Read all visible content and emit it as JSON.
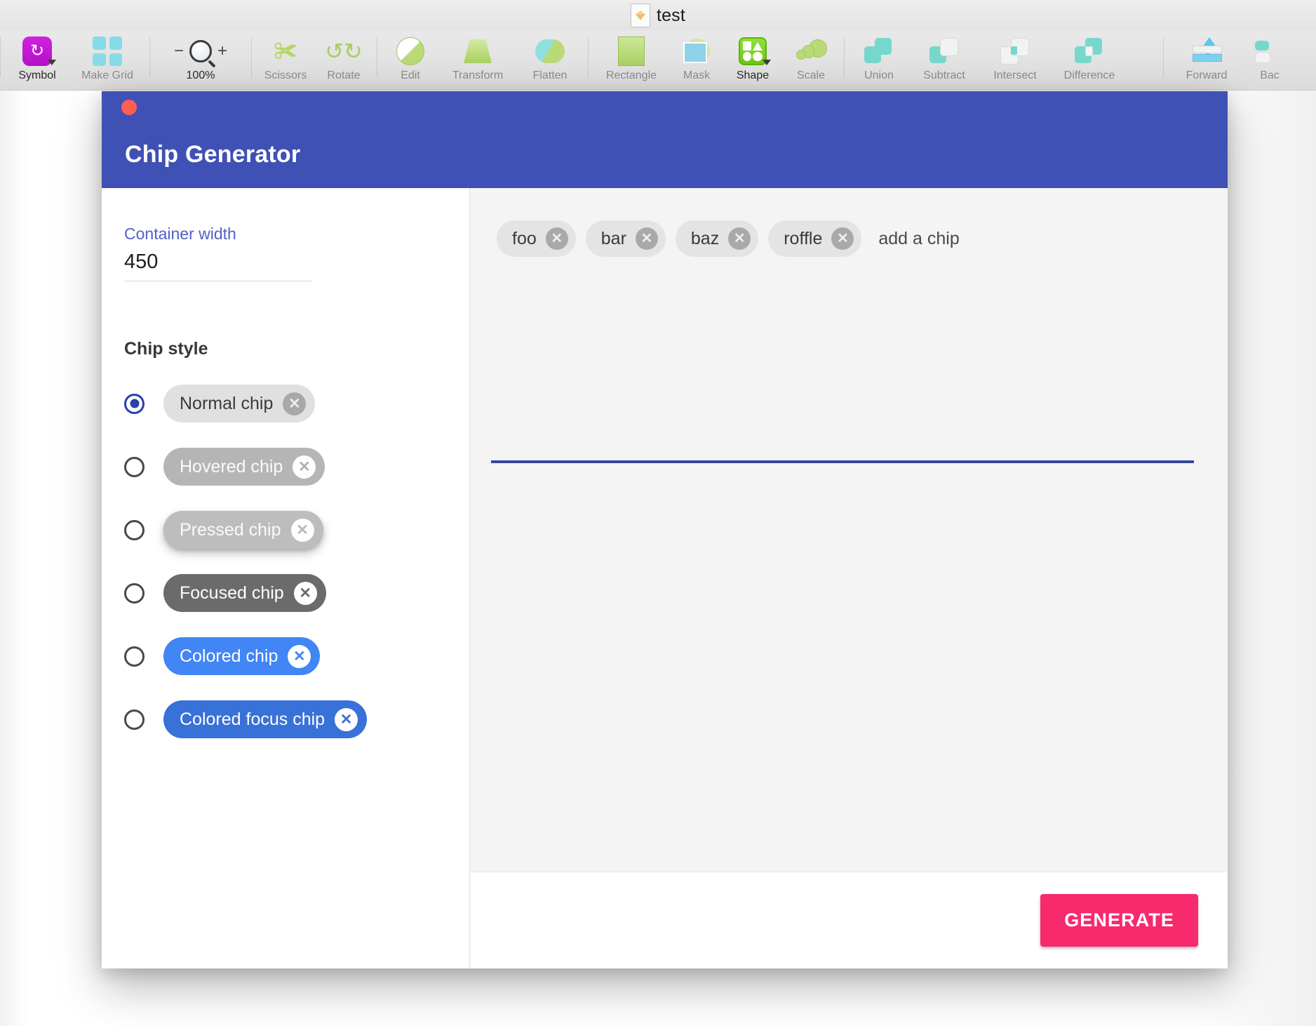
{
  "window": {
    "document_title": "test",
    "document_icon": "sketch-document-icon"
  },
  "toolbar": {
    "items": [
      {
        "label": "Symbol",
        "icon": "symbol-icon",
        "active": true,
        "has_caret": true
      },
      {
        "label": "Make Grid",
        "icon": "make-grid-icon",
        "active": false,
        "has_caret": false
      },
      {
        "label": "100%",
        "icon": "zoom-icon",
        "active": true,
        "has_caret": false
      },
      {
        "label": "Scissors",
        "icon": "scissors-icon",
        "active": false,
        "has_caret": false
      },
      {
        "label": "Rotate",
        "icon": "rotate-icon",
        "active": false,
        "has_caret": false
      },
      {
        "label": "Edit",
        "icon": "edit-icon",
        "active": false,
        "has_caret": false
      },
      {
        "label": "Transform",
        "icon": "transform-icon",
        "active": false,
        "has_caret": false
      },
      {
        "label": "Flatten",
        "icon": "flatten-icon",
        "active": false,
        "has_caret": false
      },
      {
        "label": "Rectangle",
        "icon": "rectangle-icon",
        "active": false,
        "has_caret": false
      },
      {
        "label": "Mask",
        "icon": "mask-icon",
        "active": false,
        "has_caret": false
      },
      {
        "label": "Shape",
        "icon": "shape-icon",
        "active": true,
        "has_caret": true
      },
      {
        "label": "Scale",
        "icon": "scale-icon",
        "active": false,
        "has_caret": false
      },
      {
        "label": "Union",
        "icon": "union-icon",
        "active": false,
        "has_caret": false
      },
      {
        "label": "Subtract",
        "icon": "subtract-icon",
        "active": false,
        "has_caret": false
      },
      {
        "label": "Intersect",
        "icon": "intersect-icon",
        "active": false,
        "has_caret": false
      },
      {
        "label": "Difference",
        "icon": "difference-icon",
        "active": false,
        "has_caret": false
      },
      {
        "label": "Forward",
        "icon": "bring-forward-icon",
        "active": false,
        "has_caret": false
      },
      {
        "label": "Bac",
        "icon": "send-backward-icon",
        "active": false,
        "has_caret": false
      }
    ],
    "zoom_minus": "−",
    "zoom_plus": "+"
  },
  "dialog": {
    "title": "Chip Generator",
    "header_color": "#3f51b5",
    "close_button": "close-window-button",
    "left": {
      "container_width": {
        "label": "Container width",
        "value": "450"
      },
      "chip_style": {
        "title": "Chip style",
        "options": [
          {
            "label": "Normal chip",
            "selected": true,
            "variant": "chip-normal",
            "close_glyph": "✕"
          },
          {
            "label": "Hovered chip",
            "selected": false,
            "variant": "chip-hovered",
            "close_glyph": "✕"
          },
          {
            "label": "Pressed chip",
            "selected": false,
            "variant": "chip-pressed",
            "close_glyph": "✕"
          },
          {
            "label": "Focused chip",
            "selected": false,
            "variant": "chip-focused",
            "close_glyph": "✕"
          },
          {
            "label": "Colored chip",
            "selected": false,
            "variant": "chip-colored",
            "close_glyph": "✕"
          },
          {
            "label": "Colored focus chip",
            "selected": false,
            "variant": "chip-colored-focus",
            "close_glyph": "✕"
          }
        ]
      }
    },
    "right": {
      "chips": [
        {
          "label": "foo",
          "close_glyph": "✕"
        },
        {
          "label": "bar",
          "close_glyph": "✕"
        },
        {
          "label": "baz",
          "close_glyph": "✕"
        },
        {
          "label": "roffle",
          "close_glyph": "✕"
        }
      ],
      "input_placeholder": "add a chip",
      "input_value": "",
      "input_underline_color": "#37489e"
    },
    "footer": {
      "generate_label": "GENERATE",
      "generate_color": "#f72a6d"
    }
  }
}
